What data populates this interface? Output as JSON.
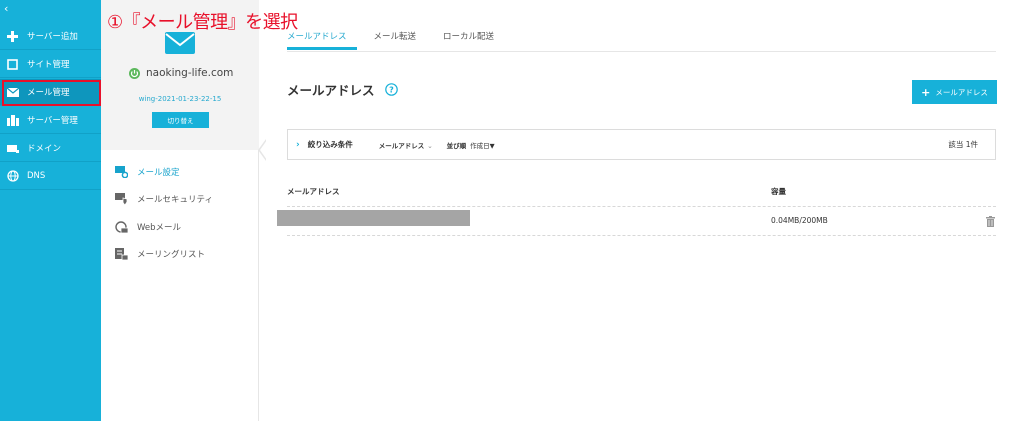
{
  "annotation": "①『メール管理』を選択",
  "sidebar": {
    "collapse_icon": "‹",
    "items": [
      {
        "label": "サーバー追加",
        "icon": "plus-icon"
      },
      {
        "label": "サイト管理",
        "icon": "window-icon"
      },
      {
        "label": "メール管理",
        "icon": "envelope-icon"
      },
      {
        "label": "サーバー管理",
        "icon": "server-icon"
      },
      {
        "label": "ドメイン",
        "icon": "domain-icon"
      },
      {
        "label": "DNS",
        "icon": "globe-icon"
      }
    ]
  },
  "panel": {
    "domain": "naoking-life.com",
    "server_id": "wing-2021-01-23-22-15",
    "switch_label": "切り替え",
    "menu": [
      {
        "label": "メール設定",
        "icon": "mail-settings-icon"
      },
      {
        "label": "メールセキュリティ",
        "icon": "mail-security-icon"
      },
      {
        "label": "Webメール",
        "icon": "webmail-icon"
      },
      {
        "label": "メーリングリスト",
        "icon": "mailing-list-icon"
      }
    ]
  },
  "tabs": [
    "メールアドレス",
    "メール転送",
    "ローカル配送"
  ],
  "page_title": "メールアドレス",
  "add_button": "メールアドレス",
  "filter": {
    "label": "絞り込み条件",
    "field": "メールアドレス",
    "sort_label": "並び順",
    "sort_value": "作成日▼",
    "count": "該当 1件"
  },
  "table": {
    "headers": [
      "メールアドレス",
      "容量"
    ],
    "rows": [
      {
        "email": "",
        "capacity": "0.04MB/200MB"
      }
    ]
  },
  "colors": {
    "accent": "#17b1d9",
    "annotation": "#e8102a"
  }
}
